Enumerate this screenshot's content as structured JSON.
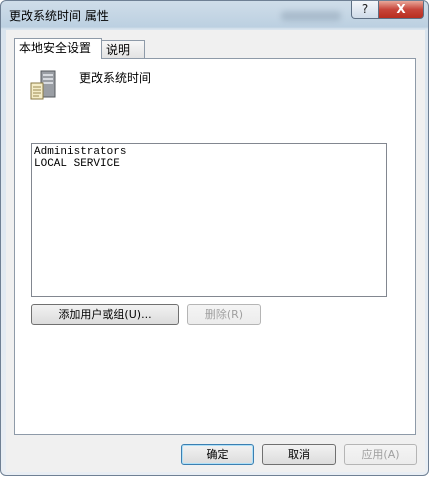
{
  "window": {
    "title": "更改系统时间 属性",
    "help_glyph": "?",
    "close_glyph": "X"
  },
  "tabs": [
    {
      "label": "本地安全设置",
      "active": true
    },
    {
      "label": "说明",
      "active": false
    }
  ],
  "policy": {
    "name": "更改系统时间",
    "icon": "server-computer-icon"
  },
  "accounts": [
    "Administrators",
    "LOCAL SERVICE"
  ],
  "buttons": {
    "add": "添加用户或组(U)...",
    "remove": "删除(R)",
    "ok": "确定",
    "cancel": "取消",
    "apply": "应用(A)"
  }
}
